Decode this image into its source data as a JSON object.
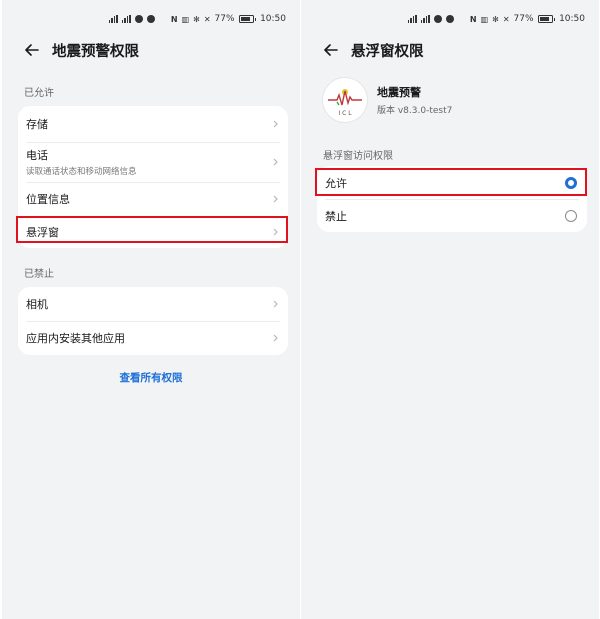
{
  "status_bar": {
    "battery": "77%",
    "time": "10:50",
    "battery_level": 0.77,
    "icons": [
      "signal-icon",
      "wifi-icon",
      "nfc-icon",
      "vibrate-icon",
      "bluetooth-icon",
      "mute-icon",
      "battery-icon"
    ]
  },
  "left": {
    "title": "地震预警权限",
    "allowed_label": "已允许",
    "allowed_items": [
      {
        "label": "存储"
      },
      {
        "label": "电话",
        "sub": "读取通话状态和移动网络信息"
      },
      {
        "label": "位置信息"
      },
      {
        "label": "悬浮窗"
      }
    ],
    "denied_label": "已禁止",
    "denied_items": [
      {
        "label": "相机"
      },
      {
        "label": "应用内安装其他应用"
      }
    ],
    "view_all": "查看所有权限"
  },
  "right": {
    "title": "悬浮窗权限",
    "app_name": "地震预警",
    "app_version": "版本 v8.3.0-test7",
    "app_icon_letters": "I C L",
    "section_label": "悬浮窗访问权限",
    "options": [
      {
        "label": "允许",
        "selected": true
      },
      {
        "label": "禁止",
        "selected": false
      }
    ]
  },
  "colors": {
    "accent": "#1f6fd6",
    "highlight_border": "#e0131c",
    "background": "#f1f3f5"
  }
}
